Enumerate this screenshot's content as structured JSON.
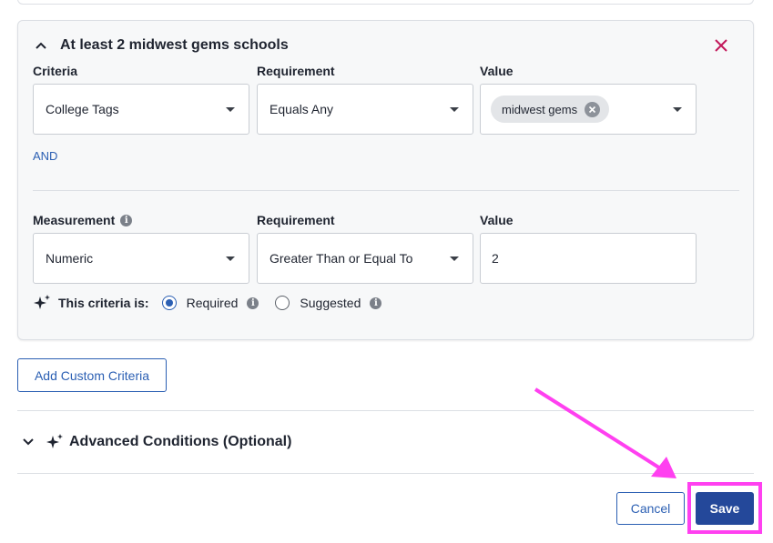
{
  "card": {
    "title": "At least 2 midwest gems schools"
  },
  "criteria_row": {
    "criteria_label": "Criteria",
    "requirement_label": "Requirement",
    "value_label": "Value",
    "criteria_value": "College Tags",
    "requirement_value": "Equals Any",
    "value_chip": "midwest gems"
  },
  "and_link": "AND",
  "measurement_row": {
    "measurement_label": "Measurement",
    "requirement_label": "Requirement",
    "value_label": "Value",
    "measurement_value": "Numeric",
    "requirement_value": "Greater Than or Equal To",
    "value_input": "2"
  },
  "criteria_type": {
    "label": "This criteria is:",
    "options": [
      {
        "label": "Required",
        "selected": true
      },
      {
        "label": "Suggested",
        "selected": false
      }
    ]
  },
  "add_custom_criteria": "Add Custom Criteria",
  "advanced_conditions": "Advanced Conditions (Optional)",
  "footer": {
    "cancel": "Cancel",
    "save": "Save"
  },
  "colors": {
    "accent": "#2b5fb3",
    "primary_button": "#24489a",
    "close_icon": "#c2185b",
    "annotation": "#ff40f0"
  },
  "icons": [
    "chevron-up-icon",
    "close-icon",
    "caret-down-icon",
    "chip-remove-icon",
    "info-icon",
    "sparkle-icon",
    "chevron-down-icon",
    "annotation-arrow"
  ]
}
